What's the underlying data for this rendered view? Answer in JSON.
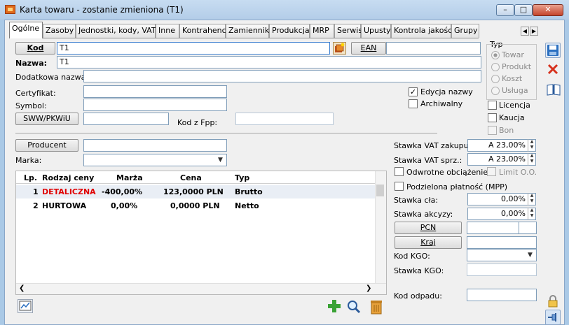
{
  "window": {
    "title": "Karta towaru - zostanie zmieniona (T1)",
    "minimize_glyph": "–",
    "maximize_glyph": "□",
    "close_glyph": "✕"
  },
  "tabs": [
    {
      "label": "Ogólne",
      "active": true
    },
    {
      "label": "Zasoby"
    },
    {
      "label": "Jednostki, kody, VAT"
    },
    {
      "label": "Inne"
    },
    {
      "label": "Kontrahenci"
    },
    {
      "label": "Zamienniki"
    },
    {
      "label": "Produkcja"
    },
    {
      "label": "MRP"
    },
    {
      "label": "Serwis"
    },
    {
      "label": "Upusty"
    },
    {
      "label": "Kontrola jakości"
    },
    {
      "label": "Grupy"
    }
  ],
  "tab_scroll": {
    "left": "◀",
    "right": "▶"
  },
  "form": {
    "kod_button": "Kod",
    "kod_value": "T1",
    "ean_button": "EAN",
    "ean_value": "",
    "nazwa_label": "Nazwa:",
    "nazwa_value": "T1",
    "dodatkowa_label": "Dodatkowa nazwa:",
    "dodatkowa_value": "",
    "certyfikat_label": "Certyfikat:",
    "certyfikat_value": "",
    "symbol_label": "Symbol:",
    "symbol_value": "",
    "sww_button": "SWW/PKWiU",
    "sww_value": "",
    "kod_fpp_label": "Kod z Fpp:",
    "kod_fpp_value": "",
    "edycja_label": "Edycja nazwy",
    "edycja_checked": "✓",
    "archiwalny_label": "Archiwalny",
    "producent_button": "Producent",
    "producent_value": "",
    "marka_label": "Marka:",
    "marka_value": ""
  },
  "typ": {
    "title": "Typ",
    "options": [
      "Towar",
      "Produkt",
      "Koszt",
      "Usługa"
    ]
  },
  "flags": {
    "licencja": "Licencja",
    "kaucja": "Kaucja",
    "bon": "Bon"
  },
  "prices": {
    "columns": [
      "Lp.",
      "Rodzaj ceny",
      "Marża",
      "Cena",
      "Typ"
    ],
    "rows": [
      {
        "lp": "1",
        "rodzaj": "DETALICZNA",
        "marza": "-400,00%",
        "cena": "123,0000 PLN",
        "typ": "Brutto",
        "color": "#e00000"
      },
      {
        "lp": "2",
        "rodzaj": "HURTOWA",
        "marza": "0,00%",
        "cena": "0,0000 PLN",
        "typ": "Netto",
        "color": "#000000"
      }
    ]
  },
  "vat": {
    "zakupu_label": "Stawka VAT zakupu:",
    "zakupu_value": "A 23,00%",
    "sprz_label": "Stawka VAT sprz.:",
    "sprz_value": "A 23,00%",
    "odwrotne_label": "Odwrotne obciążenie",
    "limit_label": "Limit O.O.",
    "podzielona_label": "Podzielona płatność (MPP)",
    "cla_label": "Stawka cła:",
    "cla_value": "0,00%",
    "akcyzy_label": "Stawka akcyzy:",
    "akcyzy_value": "0,00%",
    "pcn_button": "PCN",
    "kraj_button": "Kraj",
    "kod_kgo_label": "Kod KGO:",
    "stawka_kgo_label": "Stawka KGO:",
    "kod_odpadu_label": "Kod odpadu:"
  },
  "icons": {
    "save": "save-icon",
    "cancel": "cancel-icon",
    "book": "book-icon",
    "lock": "lock-icon",
    "pin": "pin-icon",
    "add": "add-icon",
    "search": "search-icon",
    "delete": "trash-icon",
    "chart": "chart-icon",
    "lookup": "lookup-icon"
  },
  "colors": {
    "accent": "#2a6fc0",
    "detaliczna": "#e00000"
  }
}
